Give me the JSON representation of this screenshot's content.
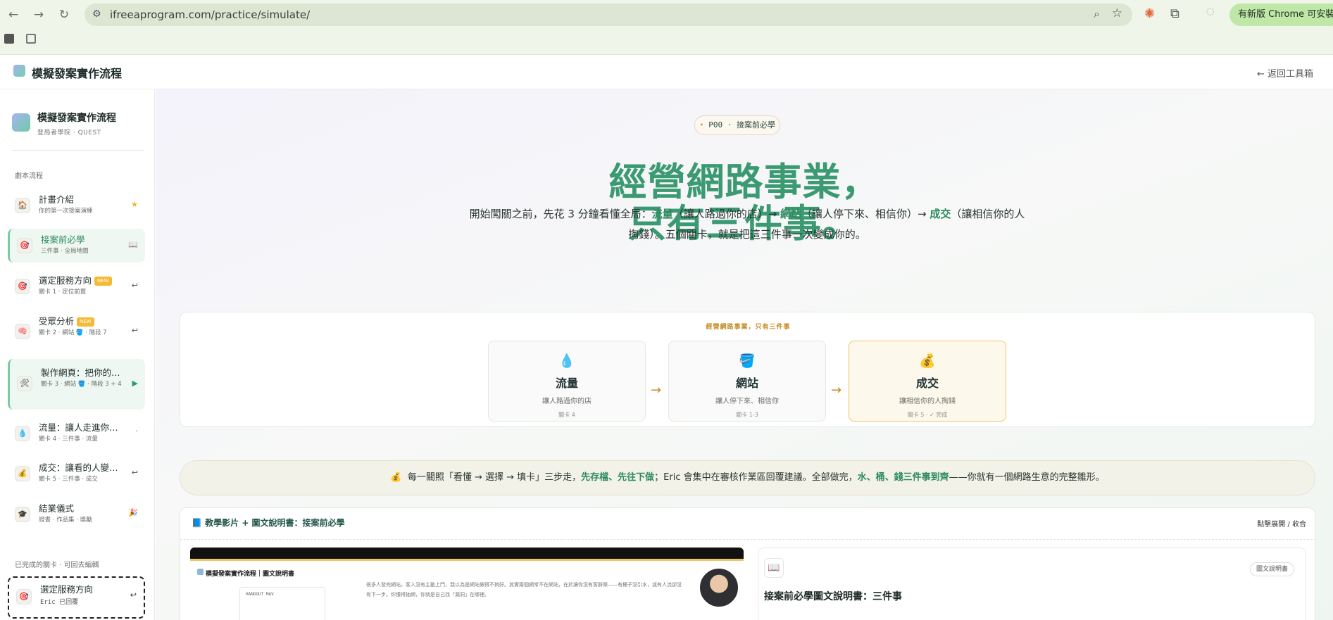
{
  "browser": {
    "url": "ifreeaprogram.com/practice/simulate/",
    "update_label": "有新版 Chrome 可安裝"
  },
  "appbar": {
    "title": "模擬發案實作流程",
    "back_label": "← 返回工具箱"
  },
  "sidebar": {
    "title": "模擬發案實作流程",
    "subtitle": "登局者學院 · QUEST",
    "section_label": "劇本流程",
    "items": [
      {
        "name": "計畫介紹",
        "sub": "你的第一次接案演練",
        "icon": "house-icon",
        "status": "★"
      },
      {
        "name": "接案前必學",
        "sub": "三件事 · 全局地圖",
        "icon": "target-icon",
        "status": "📖"
      },
      {
        "name": "選定服務方向",
        "tag": "NEW",
        "sub": "關卡 1 · 定位前置",
        "icon": "target-icon",
        "status": "↩"
      },
      {
        "name": "受眾分析",
        "tag": "NEW",
        "sub": "關卡 2 · 網站 🪣 · 階段 7",
        "icon": "brain-icon",
        "status": "↩"
      },
      {
        "name": "製作網頁：把你的…",
        "sub": "關卡 3 · 網站 🪣 · 階段 3 + 4",
        "icon": "tools-icon",
        "status": "▶"
      },
      {
        "name": "流量：讓人走進你…",
        "sub": "關卡 4 · 三件事 · 流量",
        "icon": "droplet-icon",
        "status": "·"
      },
      {
        "name": "成交：讓看的人變…",
        "sub": "關卡 5 · 三件事 · 成交",
        "icon": "moneybag-icon",
        "status": "↩"
      },
      {
        "name": "結業儀式",
        "sub": "證書 · 作品集 · 獎勵",
        "icon": "graduation-cap-icon",
        "status": "🎉"
      }
    ],
    "done_label": "已完成的關卡 · 可回去編輯",
    "done_item": {
      "name": "選定服務方向",
      "sub": "Eric 已回覆",
      "status": "↩"
    }
  },
  "hero": {
    "pill_code": "P00",
    "pill_text": "接案前必學",
    "title_line1": "經營網路事業，",
    "title_line2": "只有三件事。",
    "lead_pre": "開始闖關之前，先花 3 分鐘看懂全局：",
    "lead_k1": "流量",
    "lead_m1": "（讓人路過你的店）→ ",
    "lead_k2": "網站",
    "lead_m2": "（讓人停下來、相信你）→ ",
    "lead_k3": "成交",
    "lead_post": "（讓相信你的人掏錢）。五個關卡，就是把這三件事一次變成你的。"
  },
  "three_things": {
    "caption": "經營網路事業，只有三件事",
    "steps": [
      {
        "title": "流量",
        "desc": "讓人路過你的店",
        "meta": "關卡 4",
        "icon": "droplet-icon",
        "glyph": "💧"
      },
      {
        "title": "網站",
        "desc": "讓人停下來、相信你",
        "meta": "關卡 1-3",
        "icon": "bucket-icon",
        "glyph": "🪣"
      },
      {
        "title": "成交",
        "desc": "讓相信你的人掏錢",
        "meta": "關卡 5 · ✓ 完成",
        "icon": "moneybag-icon",
        "glyph": "💰"
      }
    ]
  },
  "tip": {
    "pre": "每一關照「看懂 → 選擇 → 填卡」三步走，",
    "b1": "先存檔、先往下做",
    "mid": "；Eric 會集中在審核作業區回覆建議。全部做完，",
    "b2": "水、桶、錢三件事到齊",
    "post": "——你就有一個網路生意的完整雛形。"
  },
  "section": {
    "header": "教學影片 + 圖文說明書：接案前必學",
    "toggle": "點擊展開 / 收合",
    "video_title": "模擬發案實作流程｜圖文說明書",
    "video_handout": "HANDOUT MAV",
    "video_text": "很多人發完網站，客人沒有主動上門，我以為是網站做得不夠好。其實兩個網常不在網站，在於讓你沒有客群樂——有桶子沒引水，或有人流卻沒有下一步。你懂得抽網，你就是自己找「漏洞」在哪裡。",
    "doc_title": "接案前必學圖文說明書：三件事",
    "doc_tag": "圖文說明書"
  }
}
